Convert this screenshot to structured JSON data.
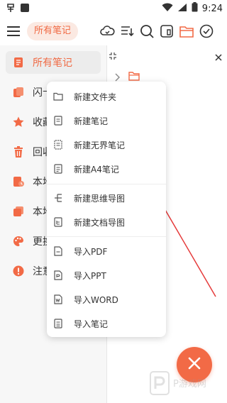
{
  "status": {
    "time": "9:24"
  },
  "header": {
    "title": "所有笔记"
  },
  "sidebar": {
    "items": [
      {
        "label": "所有笔记",
        "icon": "notes-icon",
        "active": true
      },
      {
        "label": "闪卡",
        "icon": "flashcard-icon"
      },
      {
        "label": "收藏",
        "icon": "star-icon"
      },
      {
        "label": "回收",
        "icon": "trash-icon"
      },
      {
        "label": "本地",
        "icon": "local-icon"
      },
      {
        "label": "本地",
        "icon": "copy-icon"
      },
      {
        "label": "更换",
        "icon": "palette-icon"
      },
      {
        "label": "注意",
        "icon": "alert-icon"
      }
    ]
  },
  "menu": {
    "items": [
      {
        "label": "新建文件夹",
        "icon": "folder-icon"
      },
      {
        "label": "新建笔记",
        "icon": "note-icon"
      },
      {
        "label": "新建无界笔记",
        "icon": "infinite-note-icon"
      },
      {
        "label": "新建A4笔记",
        "icon": "a4-note-icon"
      },
      {
        "label": "新建思维导图",
        "icon": "mindmap-icon"
      },
      {
        "label": "新建文档导图",
        "icon": "doc-mindmap-icon"
      },
      {
        "label": "导入PDF",
        "icon": "pdf-icon"
      },
      {
        "label": "导入PPT",
        "icon": "ppt-icon"
      },
      {
        "label": "导入WORD",
        "icon": "word-icon"
      },
      {
        "label": "导入笔记",
        "icon": "import-note-icon"
      }
    ]
  },
  "watermark": {
    "text": "P游戏网"
  },
  "colors": {
    "accent": "#f26a46",
    "annotation": "#e53b3b"
  }
}
